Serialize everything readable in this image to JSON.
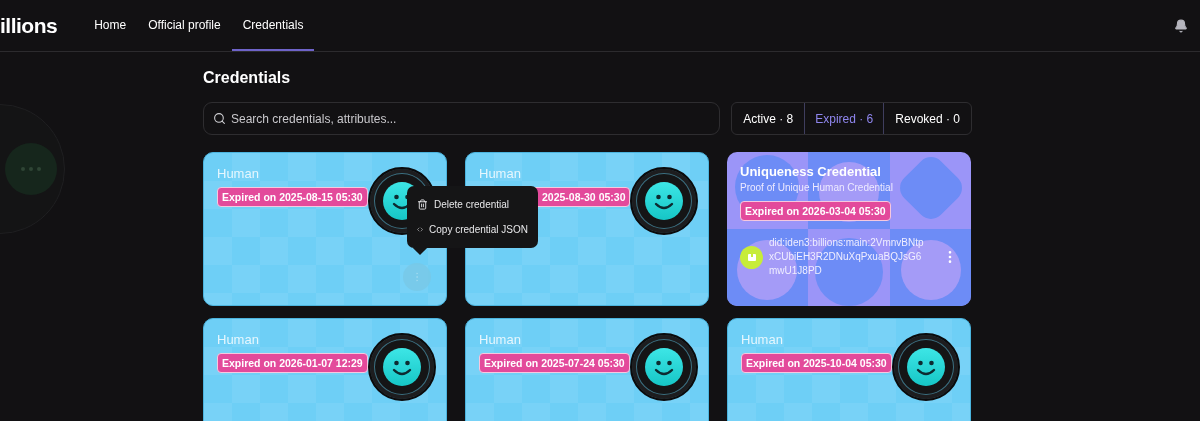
{
  "header": {
    "logo": "illions",
    "nav": [
      {
        "label": "Home",
        "selected": false
      },
      {
        "label": "Official profile",
        "selected": false
      },
      {
        "label": "Credentials",
        "selected": true
      }
    ]
  },
  "page": {
    "title": "Credentials",
    "search": {
      "placeholder": "Search credentials, attributes..."
    },
    "filters": [
      {
        "label": "Active · 8",
        "selected": false
      },
      {
        "label": "Expired · 6",
        "selected": true
      },
      {
        "label": "Revoked · 0",
        "selected": false
      }
    ]
  },
  "cards": [
    {
      "kind": "human",
      "title": "Human",
      "badge": "Expired on 2025-08-15 05:30",
      "menu_open": true
    },
    {
      "kind": "human",
      "title": "Human",
      "badge": "2025-08-30 05:30",
      "badge_covered": true,
      "menu_open": false
    },
    {
      "kind": "uniqueness",
      "title": "Uniqueness Credential",
      "subtitle": "Proof of Unique Human Credential",
      "badge": "Expired on 2026-03-04 05:30",
      "did": "did:iden3:billions:main:2VmnvBNtpxCUbiEH3R2DNuXqPxuaBQJsG6mwU1J8PD",
      "menu_open": false
    },
    {
      "kind": "human",
      "title": "Human",
      "badge": "Expired on 2026-01-07 12:29",
      "menu_open": false
    },
    {
      "kind": "human",
      "title": "Human",
      "badge": "Expired on 2025-07-24 05:30",
      "menu_open": false
    },
    {
      "kind": "human",
      "title": "Human",
      "badge": "Expired on 2025-10-04 05:30",
      "menu_open": false
    }
  ],
  "context_menu": {
    "items": [
      {
        "kind": "delete",
        "label": "Delete credential"
      },
      {
        "kind": "code",
        "label": "Copy credential JSON"
      }
    ]
  }
}
